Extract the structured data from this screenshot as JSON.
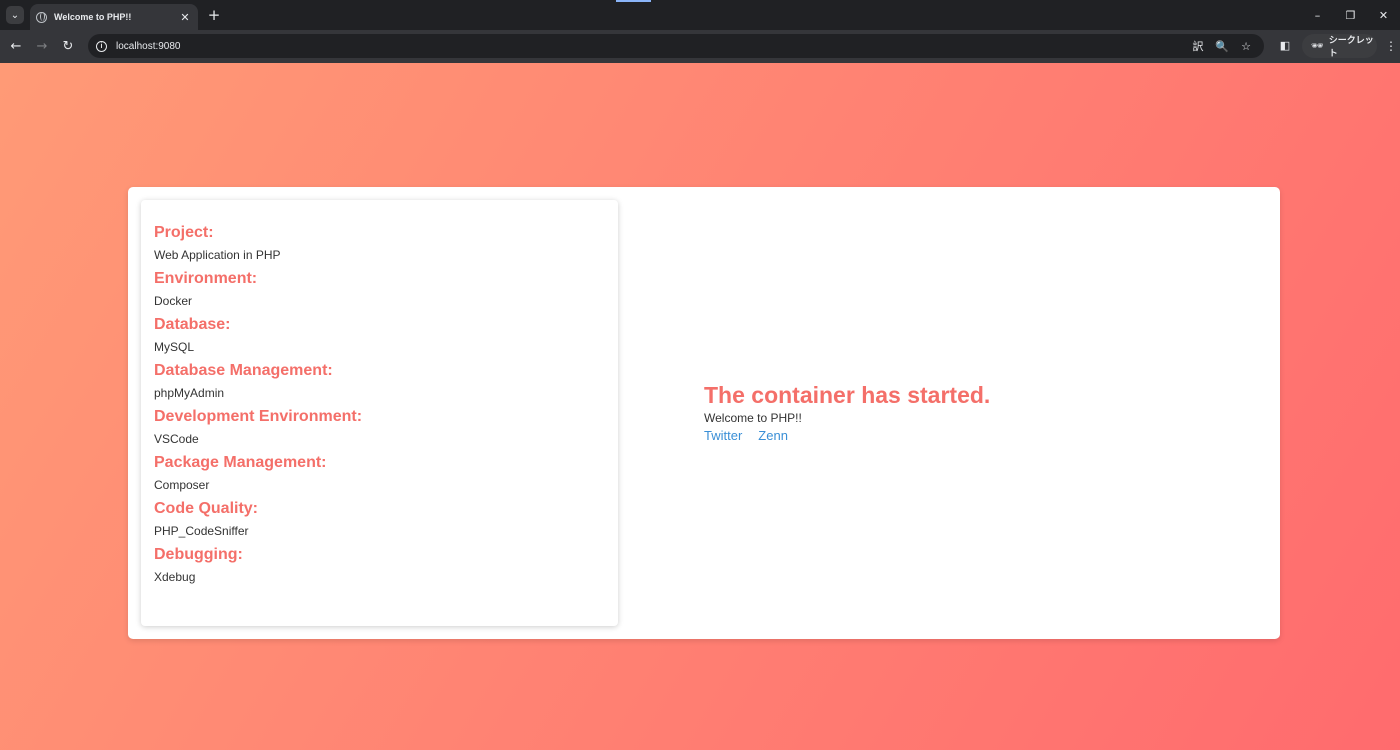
{
  "browser": {
    "tab": {
      "title": "Welcome to PHP!!",
      "close_glyph": "✕"
    },
    "tab_search_glyph": "⌄",
    "new_tab_glyph": "+",
    "window_controls": {
      "minimize": "–",
      "restore": "❐",
      "close": "✕"
    },
    "nav": {
      "back": "←",
      "forward": "→",
      "reload": "↻"
    },
    "omnibox": {
      "info_glyph": "i",
      "url": "localhost:9080",
      "actions": [
        {
          "name": "translate-icon",
          "glyph": "訳"
        },
        {
          "name": "zoom-icon",
          "glyph": "🔍"
        },
        {
          "name": "bookmark-star-icon",
          "glyph": "☆"
        }
      ]
    },
    "side_panel_glyph": "◧",
    "incognito": {
      "icon": "🕶",
      "label": "シークレット"
    },
    "menu_glyph": "⋮",
    "active_color": "#8ab4f8"
  },
  "page": {
    "info_items": [
      {
        "heading": "Project:",
        "value": "Web Application in PHP"
      },
      {
        "heading": "Environment:",
        "value": "Docker"
      },
      {
        "heading": "Database:",
        "value": "MySQL"
      },
      {
        "heading": "Database Management:",
        "value": "phpMyAdmin"
      },
      {
        "heading": "Development Environment:",
        "value": "VSCode"
      },
      {
        "heading": "Package Management:",
        "value": "Composer"
      },
      {
        "heading": "Code Quality:",
        "value": "PHP_CodeSniffer"
      },
      {
        "heading": "Debugging:",
        "value": "Xdebug"
      }
    ],
    "welcome": {
      "title": "The container has started.",
      "text": "Welcome to PHP!!",
      "links": [
        "Twitter",
        "Zenn"
      ]
    },
    "colors": {
      "accent": "#f46f69",
      "link": "#3a8fd6",
      "gradient_start": "#ff9a76",
      "gradient_end": "#ff6b6e"
    }
  }
}
